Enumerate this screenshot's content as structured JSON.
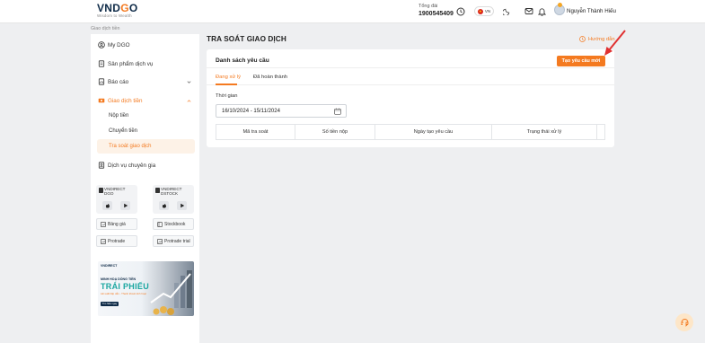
{
  "header": {
    "logo_text": "VNDGO",
    "logo_tagline": "Wisdom to Wealth",
    "hotline_label": "Tổng đài",
    "hotline_number": "1900545409",
    "language": "VN",
    "username": "Nguyễn Thành Hiếu"
  },
  "breadcrumb": "Giao dịch tiền",
  "sidebar": {
    "items": [
      {
        "label": "My DGO"
      },
      {
        "label": "Sản phẩm dịch vụ"
      },
      {
        "label": "Báo cáo"
      },
      {
        "label": "Giao dịch tiền"
      },
      {
        "label": "Dịch vụ chuyên gia"
      }
    ],
    "sub_items": [
      {
        "label": "Nộp tiền"
      },
      {
        "label": "Chuyển tiền"
      },
      {
        "label": "Tra soát giao dịch"
      }
    ],
    "apps": [
      {
        "line1": "VNDIRECT",
        "line2": "DGO"
      },
      {
        "line1": "VNDIRECT",
        "line2": "DSTOCK"
      }
    ],
    "tools": [
      {
        "label": "Bảng giá"
      },
      {
        "label": "Stockbook"
      },
      {
        "label": "Protrade"
      },
      {
        "label": "Protrade trial"
      }
    ],
    "banner": {
      "logo": "VNDIRECT",
      "line1": "MINH HOẠ DÒNG TIỀN",
      "line2": "TRÁI PHIẾU",
      "line3": "Lãi suất hấp dẫn - Thanh khoản linh hoạt",
      "button": "Tìm hiểu ngay"
    }
  },
  "main": {
    "title": "TRA SOÁT GIAO DỊCH",
    "guide_label": "Hướng dẫn",
    "card_title": "Danh sách yêu cầu",
    "create_button": "Tạo yêu cầu mới",
    "tabs": [
      {
        "label": "Đang xử lý",
        "active": true
      },
      {
        "label": "Đã hoàn thành",
        "active": false
      }
    ],
    "date_label": "Thời gian",
    "date_range": "16/10/2024 - 15/11/2024",
    "table_headers": [
      "Mã tra soát",
      "Số tiền nộp",
      "Ngày tạo yêu cầu",
      "Trạng thái xử lý"
    ]
  },
  "colors": {
    "accent": "#f47a20",
    "brand_navy": "#0e2a47",
    "annotation_arrow": "#e03131"
  }
}
